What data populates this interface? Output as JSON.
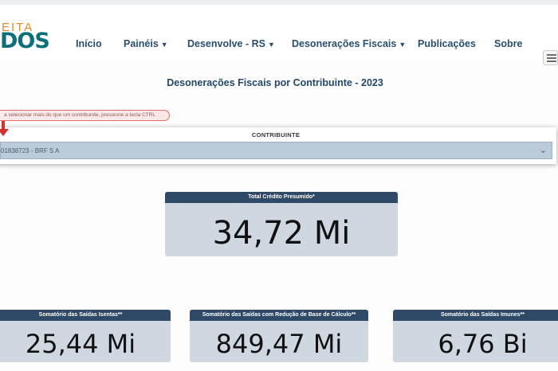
{
  "header": {
    "logo_top": "EITA",
    "logo_main": "DOS",
    "nav": [
      {
        "label": "Início",
        "has_dropdown": false
      },
      {
        "label": "Painéis",
        "has_dropdown": true
      },
      {
        "label": "Desenvolve - RS",
        "has_dropdown": true
      },
      {
        "label": "Desonerações Fiscais",
        "has_dropdown": true
      },
      {
        "label": "Publicações",
        "has_dropdown": false
      },
      {
        "label": "Sobre",
        "has_dropdown": false
      }
    ],
    "menu_icon": "hamburger-icon"
  },
  "page_title": "Desonerações Fiscais por Contribuinte - 2023",
  "hint_text": "a selecionar mais do que um contribuinte, pressione a tecla CTRL",
  "filter": {
    "label": "CONTRIBUINTE",
    "selected_value": "01838723 - BRF S A",
    "chevron_icon": "chevron-down-icon"
  },
  "cards": {
    "main": {
      "title": "Total Crédito Presumido*",
      "value": "34,72 Mi"
    },
    "isentas": {
      "title": "Somatório das Saídas Isentas**",
      "value": "25,44 Mi"
    },
    "reducao": {
      "title": "Somatório das Saídas com Redução de Base de Cálculo**",
      "value": "849,47 Mi"
    },
    "imunes": {
      "title": "Somatório das Saídas Imunes**",
      "value": "6,76 Bi"
    }
  },
  "colors": {
    "nav_text": "#2a4e6e",
    "card_header": "#2f4a66",
    "card_body": "#cfd8e1",
    "select_bg": "#bccbd9",
    "logo_orange": "#e58a2e",
    "logo_teal": "#0d6f7a",
    "hint_border": "#e06e6e",
    "arrow": "#d32f2f"
  }
}
